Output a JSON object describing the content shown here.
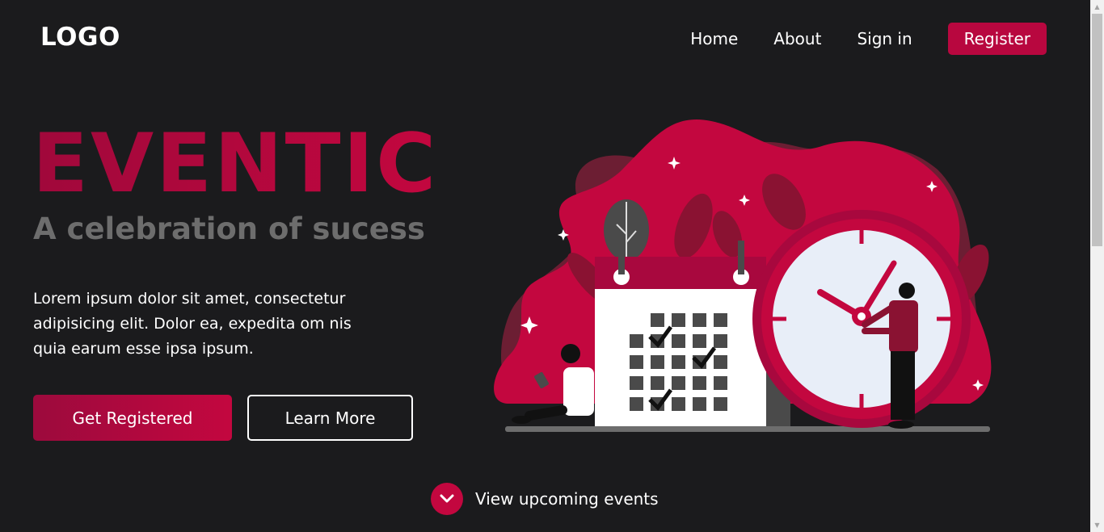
{
  "header": {
    "logo": "LOGO",
    "nav": [
      {
        "label": "Home"
      },
      {
        "label": "About"
      },
      {
        "label": "Sign in"
      }
    ],
    "register_label": "Register"
  },
  "hero": {
    "title": "EVENTIC",
    "subtitle": "A celebration of sucess",
    "description": "Lorem ipsum dolor sit amet, consectetur adipisicing elit. Dolor ea, expedita om nis quia earum esse ipsa ipsum.",
    "primary_button": "Get Registered",
    "secondary_button": "Learn More"
  },
  "scroll_cta": {
    "label": "View upcoming events",
    "icon": "chevron-down-icon"
  },
  "colors": {
    "background": "#1b1b1d",
    "accent": "#c3073f",
    "accent_dark": "#9c0a3d",
    "muted_text": "#6d6d6d"
  }
}
